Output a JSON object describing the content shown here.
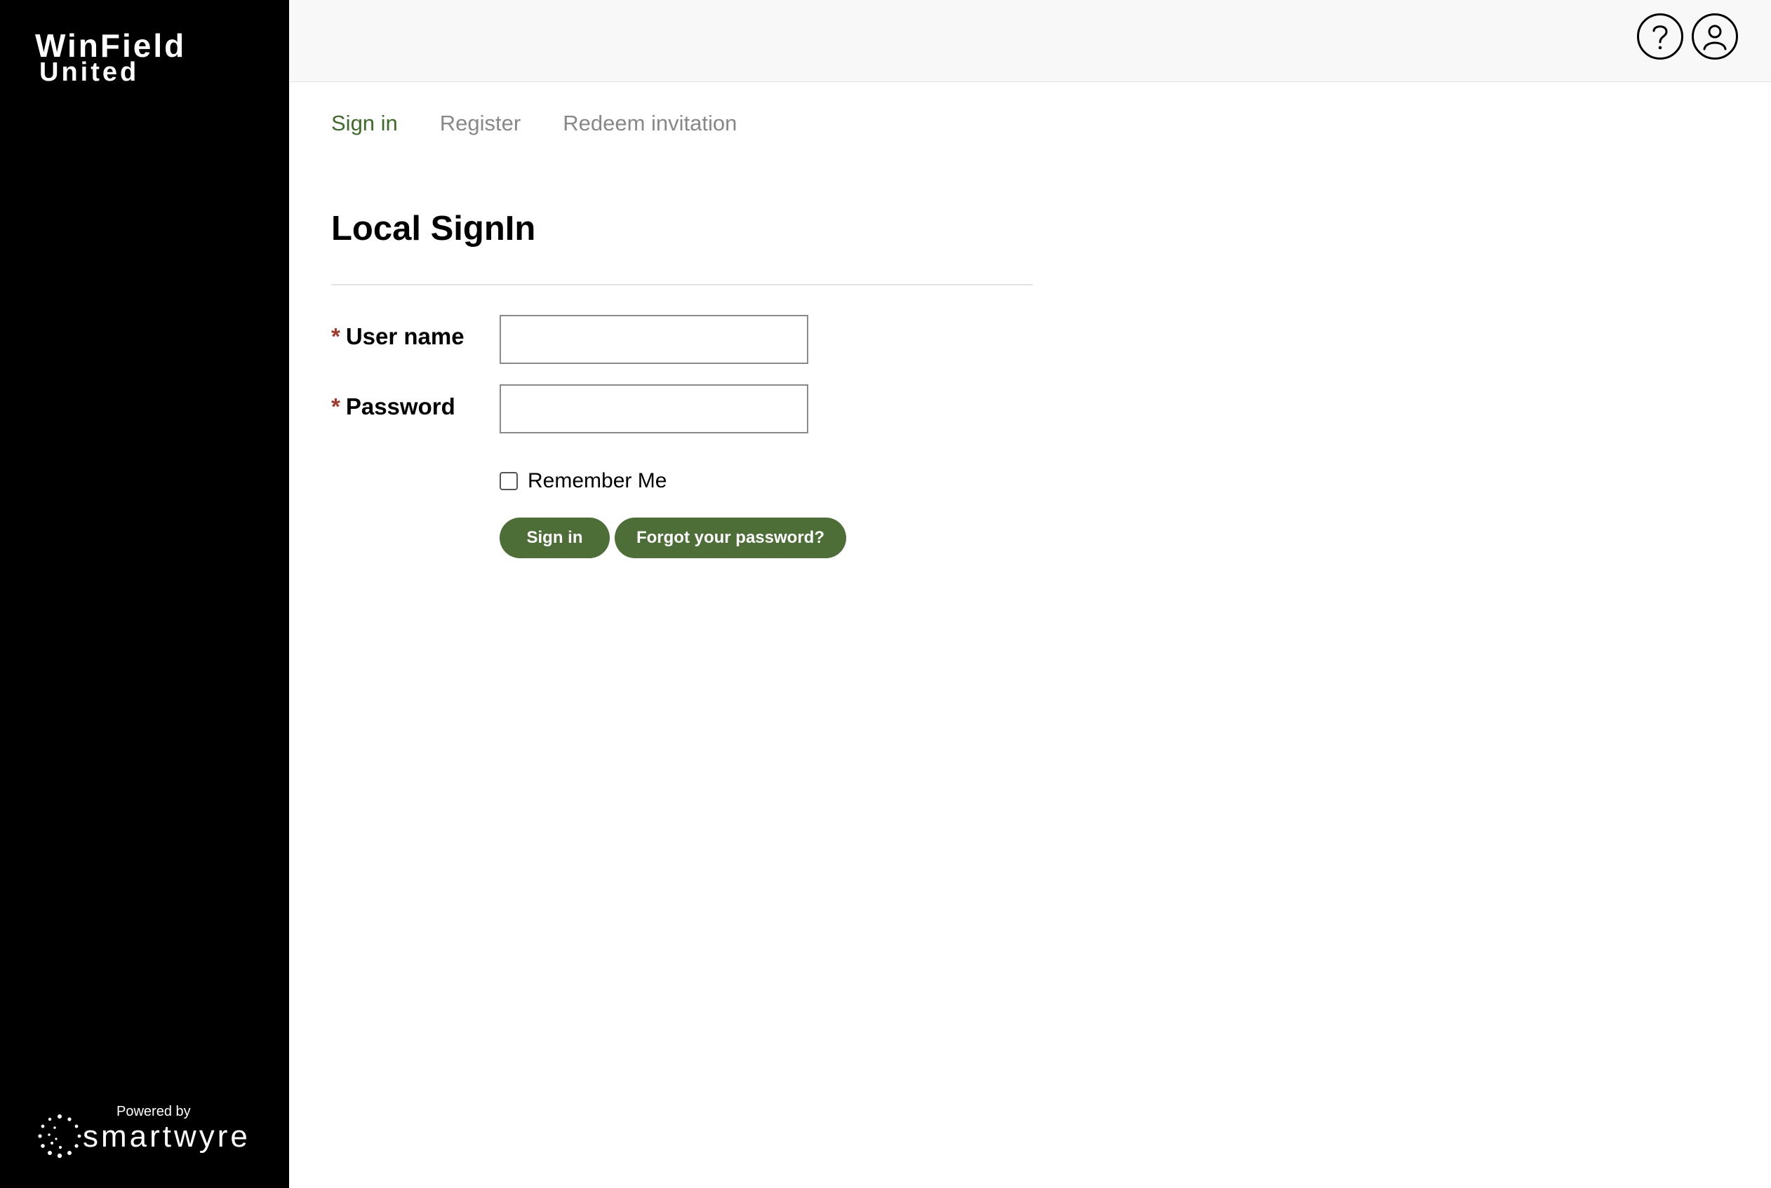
{
  "brand": {
    "logo_line1": "WinField",
    "logo_line2": "United",
    "powered_by": "Powered by",
    "powered_brand": "smartwyre"
  },
  "header": {
    "help_icon": "question-circle-icon",
    "user_icon": "user-circle-icon"
  },
  "tabs": [
    {
      "label": "Sign in",
      "active": true
    },
    {
      "label": "Register",
      "active": false
    },
    {
      "label": "Redeem invitation",
      "active": false
    }
  ],
  "page": {
    "title": "Local SignIn"
  },
  "form": {
    "required_marker": "*",
    "username_label": "User name",
    "username_value": "",
    "password_label": "Password",
    "password_value": "",
    "remember_label": "Remember Me",
    "remember_checked": false,
    "signin_button": "Sign in",
    "forgot_button": "Forgot your password?"
  },
  "colors": {
    "sidebar_bg": "#000000",
    "topbar_bg": "#f8f8f8",
    "accent_green": "#4d6e37",
    "active_tab": "#3f6b2a",
    "inactive_tab": "#888888",
    "required_marker": "#a33a2e"
  }
}
